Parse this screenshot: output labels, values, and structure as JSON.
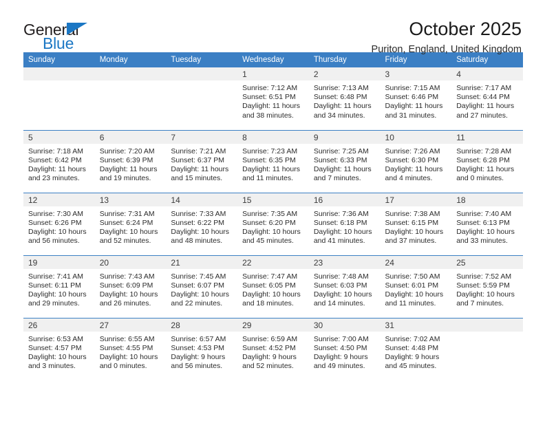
{
  "brand": {
    "name_part1": "General",
    "name_part2": "Blue",
    "accent_color": "#1b77c4"
  },
  "header": {
    "title": "October 2025",
    "subtitle": "Puriton, England, United Kingdom"
  },
  "calendar": {
    "header_bg": "#3b7fc4",
    "daynum_bg": "#f0f0f0",
    "weekday_names": [
      "Sunday",
      "Monday",
      "Tuesday",
      "Wednesday",
      "Thursday",
      "Friday",
      "Saturday"
    ],
    "weeks": [
      [
        {
          "day": "",
          "empty": true
        },
        {
          "day": "",
          "empty": true
        },
        {
          "day": "",
          "empty": true
        },
        {
          "day": "1",
          "sunrise": "Sunrise: 7:12 AM",
          "sunset": "Sunset: 6:51 PM",
          "daylight1": "Daylight: 11 hours",
          "daylight2": "and 38 minutes."
        },
        {
          "day": "2",
          "sunrise": "Sunrise: 7:13 AM",
          "sunset": "Sunset: 6:48 PM",
          "daylight1": "Daylight: 11 hours",
          "daylight2": "and 34 minutes."
        },
        {
          "day": "3",
          "sunrise": "Sunrise: 7:15 AM",
          "sunset": "Sunset: 6:46 PM",
          "daylight1": "Daylight: 11 hours",
          "daylight2": "and 31 minutes."
        },
        {
          "day": "4",
          "sunrise": "Sunrise: 7:17 AM",
          "sunset": "Sunset: 6:44 PM",
          "daylight1": "Daylight: 11 hours",
          "daylight2": "and 27 minutes."
        }
      ],
      [
        {
          "day": "5",
          "sunrise": "Sunrise: 7:18 AM",
          "sunset": "Sunset: 6:42 PM",
          "daylight1": "Daylight: 11 hours",
          "daylight2": "and 23 minutes."
        },
        {
          "day": "6",
          "sunrise": "Sunrise: 7:20 AM",
          "sunset": "Sunset: 6:39 PM",
          "daylight1": "Daylight: 11 hours",
          "daylight2": "and 19 minutes."
        },
        {
          "day": "7",
          "sunrise": "Sunrise: 7:21 AM",
          "sunset": "Sunset: 6:37 PM",
          "daylight1": "Daylight: 11 hours",
          "daylight2": "and 15 minutes."
        },
        {
          "day": "8",
          "sunrise": "Sunrise: 7:23 AM",
          "sunset": "Sunset: 6:35 PM",
          "daylight1": "Daylight: 11 hours",
          "daylight2": "and 11 minutes."
        },
        {
          "day": "9",
          "sunrise": "Sunrise: 7:25 AM",
          "sunset": "Sunset: 6:33 PM",
          "daylight1": "Daylight: 11 hours",
          "daylight2": "and 7 minutes."
        },
        {
          "day": "10",
          "sunrise": "Sunrise: 7:26 AM",
          "sunset": "Sunset: 6:30 PM",
          "daylight1": "Daylight: 11 hours",
          "daylight2": "and 4 minutes."
        },
        {
          "day": "11",
          "sunrise": "Sunrise: 7:28 AM",
          "sunset": "Sunset: 6:28 PM",
          "daylight1": "Daylight: 11 hours",
          "daylight2": "and 0 minutes."
        }
      ],
      [
        {
          "day": "12",
          "sunrise": "Sunrise: 7:30 AM",
          "sunset": "Sunset: 6:26 PM",
          "daylight1": "Daylight: 10 hours",
          "daylight2": "and 56 minutes."
        },
        {
          "day": "13",
          "sunrise": "Sunrise: 7:31 AM",
          "sunset": "Sunset: 6:24 PM",
          "daylight1": "Daylight: 10 hours",
          "daylight2": "and 52 minutes."
        },
        {
          "day": "14",
          "sunrise": "Sunrise: 7:33 AM",
          "sunset": "Sunset: 6:22 PM",
          "daylight1": "Daylight: 10 hours",
          "daylight2": "and 48 minutes."
        },
        {
          "day": "15",
          "sunrise": "Sunrise: 7:35 AM",
          "sunset": "Sunset: 6:20 PM",
          "daylight1": "Daylight: 10 hours",
          "daylight2": "and 45 minutes."
        },
        {
          "day": "16",
          "sunrise": "Sunrise: 7:36 AM",
          "sunset": "Sunset: 6:18 PM",
          "daylight1": "Daylight: 10 hours",
          "daylight2": "and 41 minutes."
        },
        {
          "day": "17",
          "sunrise": "Sunrise: 7:38 AM",
          "sunset": "Sunset: 6:15 PM",
          "daylight1": "Daylight: 10 hours",
          "daylight2": "and 37 minutes."
        },
        {
          "day": "18",
          "sunrise": "Sunrise: 7:40 AM",
          "sunset": "Sunset: 6:13 PM",
          "daylight1": "Daylight: 10 hours",
          "daylight2": "and 33 minutes."
        }
      ],
      [
        {
          "day": "19",
          "sunrise": "Sunrise: 7:41 AM",
          "sunset": "Sunset: 6:11 PM",
          "daylight1": "Daylight: 10 hours",
          "daylight2": "and 29 minutes."
        },
        {
          "day": "20",
          "sunrise": "Sunrise: 7:43 AM",
          "sunset": "Sunset: 6:09 PM",
          "daylight1": "Daylight: 10 hours",
          "daylight2": "and 26 minutes."
        },
        {
          "day": "21",
          "sunrise": "Sunrise: 7:45 AM",
          "sunset": "Sunset: 6:07 PM",
          "daylight1": "Daylight: 10 hours",
          "daylight2": "and 22 minutes."
        },
        {
          "day": "22",
          "sunrise": "Sunrise: 7:47 AM",
          "sunset": "Sunset: 6:05 PM",
          "daylight1": "Daylight: 10 hours",
          "daylight2": "and 18 minutes."
        },
        {
          "day": "23",
          "sunrise": "Sunrise: 7:48 AM",
          "sunset": "Sunset: 6:03 PM",
          "daylight1": "Daylight: 10 hours",
          "daylight2": "and 14 minutes."
        },
        {
          "day": "24",
          "sunrise": "Sunrise: 7:50 AM",
          "sunset": "Sunset: 6:01 PM",
          "daylight1": "Daylight: 10 hours",
          "daylight2": "and 11 minutes."
        },
        {
          "day": "25",
          "sunrise": "Sunrise: 7:52 AM",
          "sunset": "Sunset: 5:59 PM",
          "daylight1": "Daylight: 10 hours",
          "daylight2": "and 7 minutes."
        }
      ],
      [
        {
          "day": "26",
          "sunrise": "Sunrise: 6:53 AM",
          "sunset": "Sunset: 4:57 PM",
          "daylight1": "Daylight: 10 hours",
          "daylight2": "and 3 minutes."
        },
        {
          "day": "27",
          "sunrise": "Sunrise: 6:55 AM",
          "sunset": "Sunset: 4:55 PM",
          "daylight1": "Daylight: 10 hours",
          "daylight2": "and 0 minutes."
        },
        {
          "day": "28",
          "sunrise": "Sunrise: 6:57 AM",
          "sunset": "Sunset: 4:53 PM",
          "daylight1": "Daylight: 9 hours",
          "daylight2": "and 56 minutes."
        },
        {
          "day": "29",
          "sunrise": "Sunrise: 6:59 AM",
          "sunset": "Sunset: 4:52 PM",
          "daylight1": "Daylight: 9 hours",
          "daylight2": "and 52 minutes."
        },
        {
          "day": "30",
          "sunrise": "Sunrise: 7:00 AM",
          "sunset": "Sunset: 4:50 PM",
          "daylight1": "Daylight: 9 hours",
          "daylight2": "and 49 minutes."
        },
        {
          "day": "31",
          "sunrise": "Sunrise: 7:02 AM",
          "sunset": "Sunset: 4:48 PM",
          "daylight1": "Daylight: 9 hours",
          "daylight2": "and 45 minutes."
        },
        {
          "day": "",
          "empty": true
        }
      ]
    ]
  }
}
